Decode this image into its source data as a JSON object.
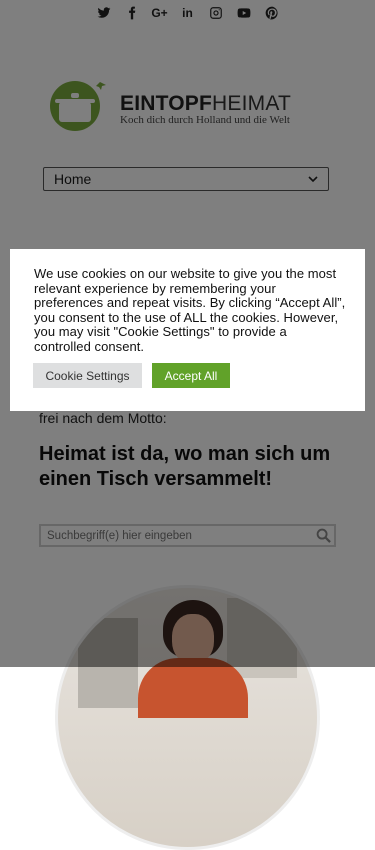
{
  "social": {
    "icons": [
      "twitter-icon",
      "facebook-icon",
      "google-plus-icon",
      "linkedin-icon",
      "instagram-icon",
      "youtube-icon",
      "pinterest-icon"
    ],
    "google_plus": "G+",
    "linkedin": "in"
  },
  "logo": {
    "title_bold": "EINTOPF",
    "title_light": "HEIMAT",
    "tagline": "Koch dich durch Holland und die Welt",
    "colors": {
      "circle": "#7bab3f",
      "pot": "#ffffff",
      "plane": "#7bab3f"
    }
  },
  "nav": {
    "selected": "Home"
  },
  "content": {
    "motto_intro": "frei nach dem Motto:",
    "motto": "Heimat ist da, wo man sich um einen Tisch versammelt!"
  },
  "search": {
    "placeholder": "Suchbegriff(e) hier eingeben"
  },
  "cookie": {
    "text": "We use cookies on our website to give you the most relevant experience by remembering your preferences and repeat visits. By clicking “Accept All”, you consent to the use of ALL the cookies. However, you may visit \"Cookie Settings\" to provide a controlled consent.",
    "settings_label": "Cookie Settings",
    "accept_label": "Accept All",
    "colors": {
      "accept": "#61a229",
      "settings": "#dedfe0"
    }
  }
}
